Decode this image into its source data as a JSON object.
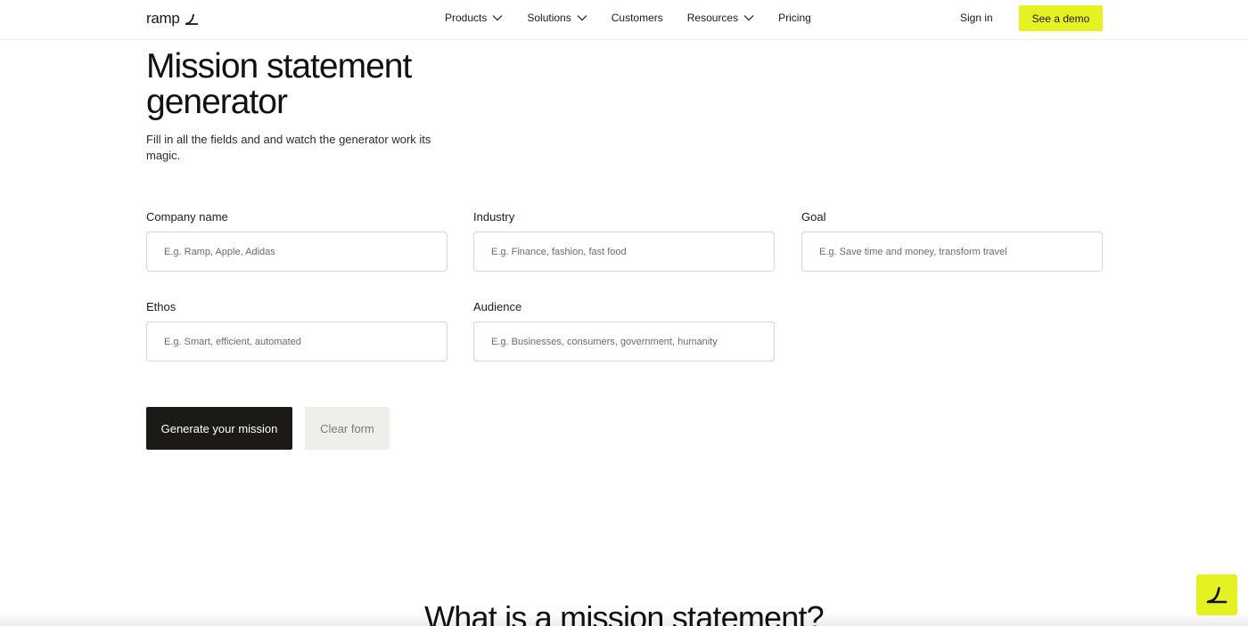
{
  "header": {
    "logo_text": "ramp",
    "nav": [
      {
        "label": "Products",
        "has_dropdown": true
      },
      {
        "label": "Solutions",
        "has_dropdown": true
      },
      {
        "label": "Customers",
        "has_dropdown": false
      },
      {
        "label": "Resources",
        "has_dropdown": true
      },
      {
        "label": "Pricing",
        "has_dropdown": false
      }
    ],
    "signin_label": "Sign in",
    "demo_label": "See a demo"
  },
  "hero": {
    "title": "Mission statement generator",
    "subtitle": "Fill in all the fields and and watch the generator work its magic."
  },
  "form": {
    "company": {
      "label": "Company name",
      "placeholder": "E.g. Ramp, Apple, Adidas",
      "value": ""
    },
    "industry": {
      "label": "Industry",
      "placeholder": "E.g. Finance, fashion, fast food",
      "value": ""
    },
    "goal": {
      "label": "Goal",
      "placeholder": "E.g. Save time and money, transform travel",
      "value": ""
    },
    "ethos": {
      "label": "Ethos",
      "placeholder": "E.g. Smart, efficient, automated",
      "value": ""
    },
    "audience": {
      "label": "Audience",
      "placeholder": "E.g. Businesses, consumers, government, humanity",
      "value": ""
    },
    "generate_label": "Generate your mission",
    "clear_label": "Clear form"
  },
  "section": {
    "heading": "What is a mission statement?"
  },
  "icons": {
    "logo": "ramp-logo-icon",
    "chevron": "chevron-down-icon",
    "chat_widget": "ramp-chat-icon"
  },
  "colors": {
    "accent": "#e4f222",
    "primary_button": "#1b1a17",
    "secondary_button": "#eeeeea",
    "input_border": "#d6d6d2"
  }
}
